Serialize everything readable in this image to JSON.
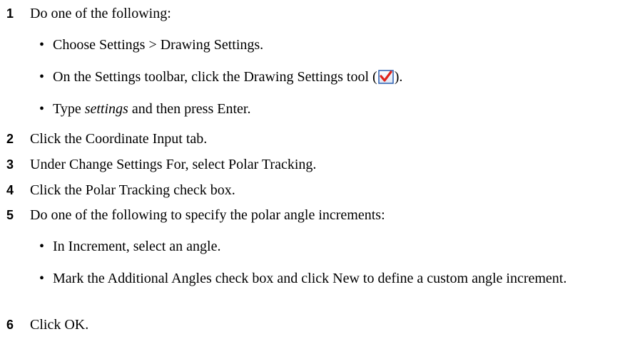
{
  "steps": [
    {
      "number": "1",
      "text": "Do one of the following:",
      "bullets": [
        {
          "text": "Choose Settings > Drawing Settings."
        },
        {
          "before": "On the Settings toolbar, click the Drawing Settings tool (",
          "icon": "drawing-settings-checkmark-icon",
          "after": ")."
        },
        {
          "emphasis": "settings",
          "after": " and then press Enter.",
          "before": "Type "
        }
      ]
    },
    {
      "number": "2",
      "text": "Click the Coordinate Input tab."
    },
    {
      "number": "3",
      "text": "Under Change Settings For, select Polar Tracking."
    },
    {
      "number": "4",
      "text": "Click the Polar Tracking check box."
    },
    {
      "number": "5",
      "text": "Do one of the following to specify the polar angle increments:",
      "bullets": [
        {
          "text": "In Increment, select an angle."
        },
        {
          "text": "Mark the Additional Angles check box and click New to define a custom angle increment."
        }
      ]
    },
    {
      "number": "6",
      "text": "Click OK."
    }
  ],
  "bullet_glyph": "•",
  "colors": {
    "text": "#000000",
    "icon_check": "#e0231b",
    "icon_border": "#2a5db0"
  }
}
